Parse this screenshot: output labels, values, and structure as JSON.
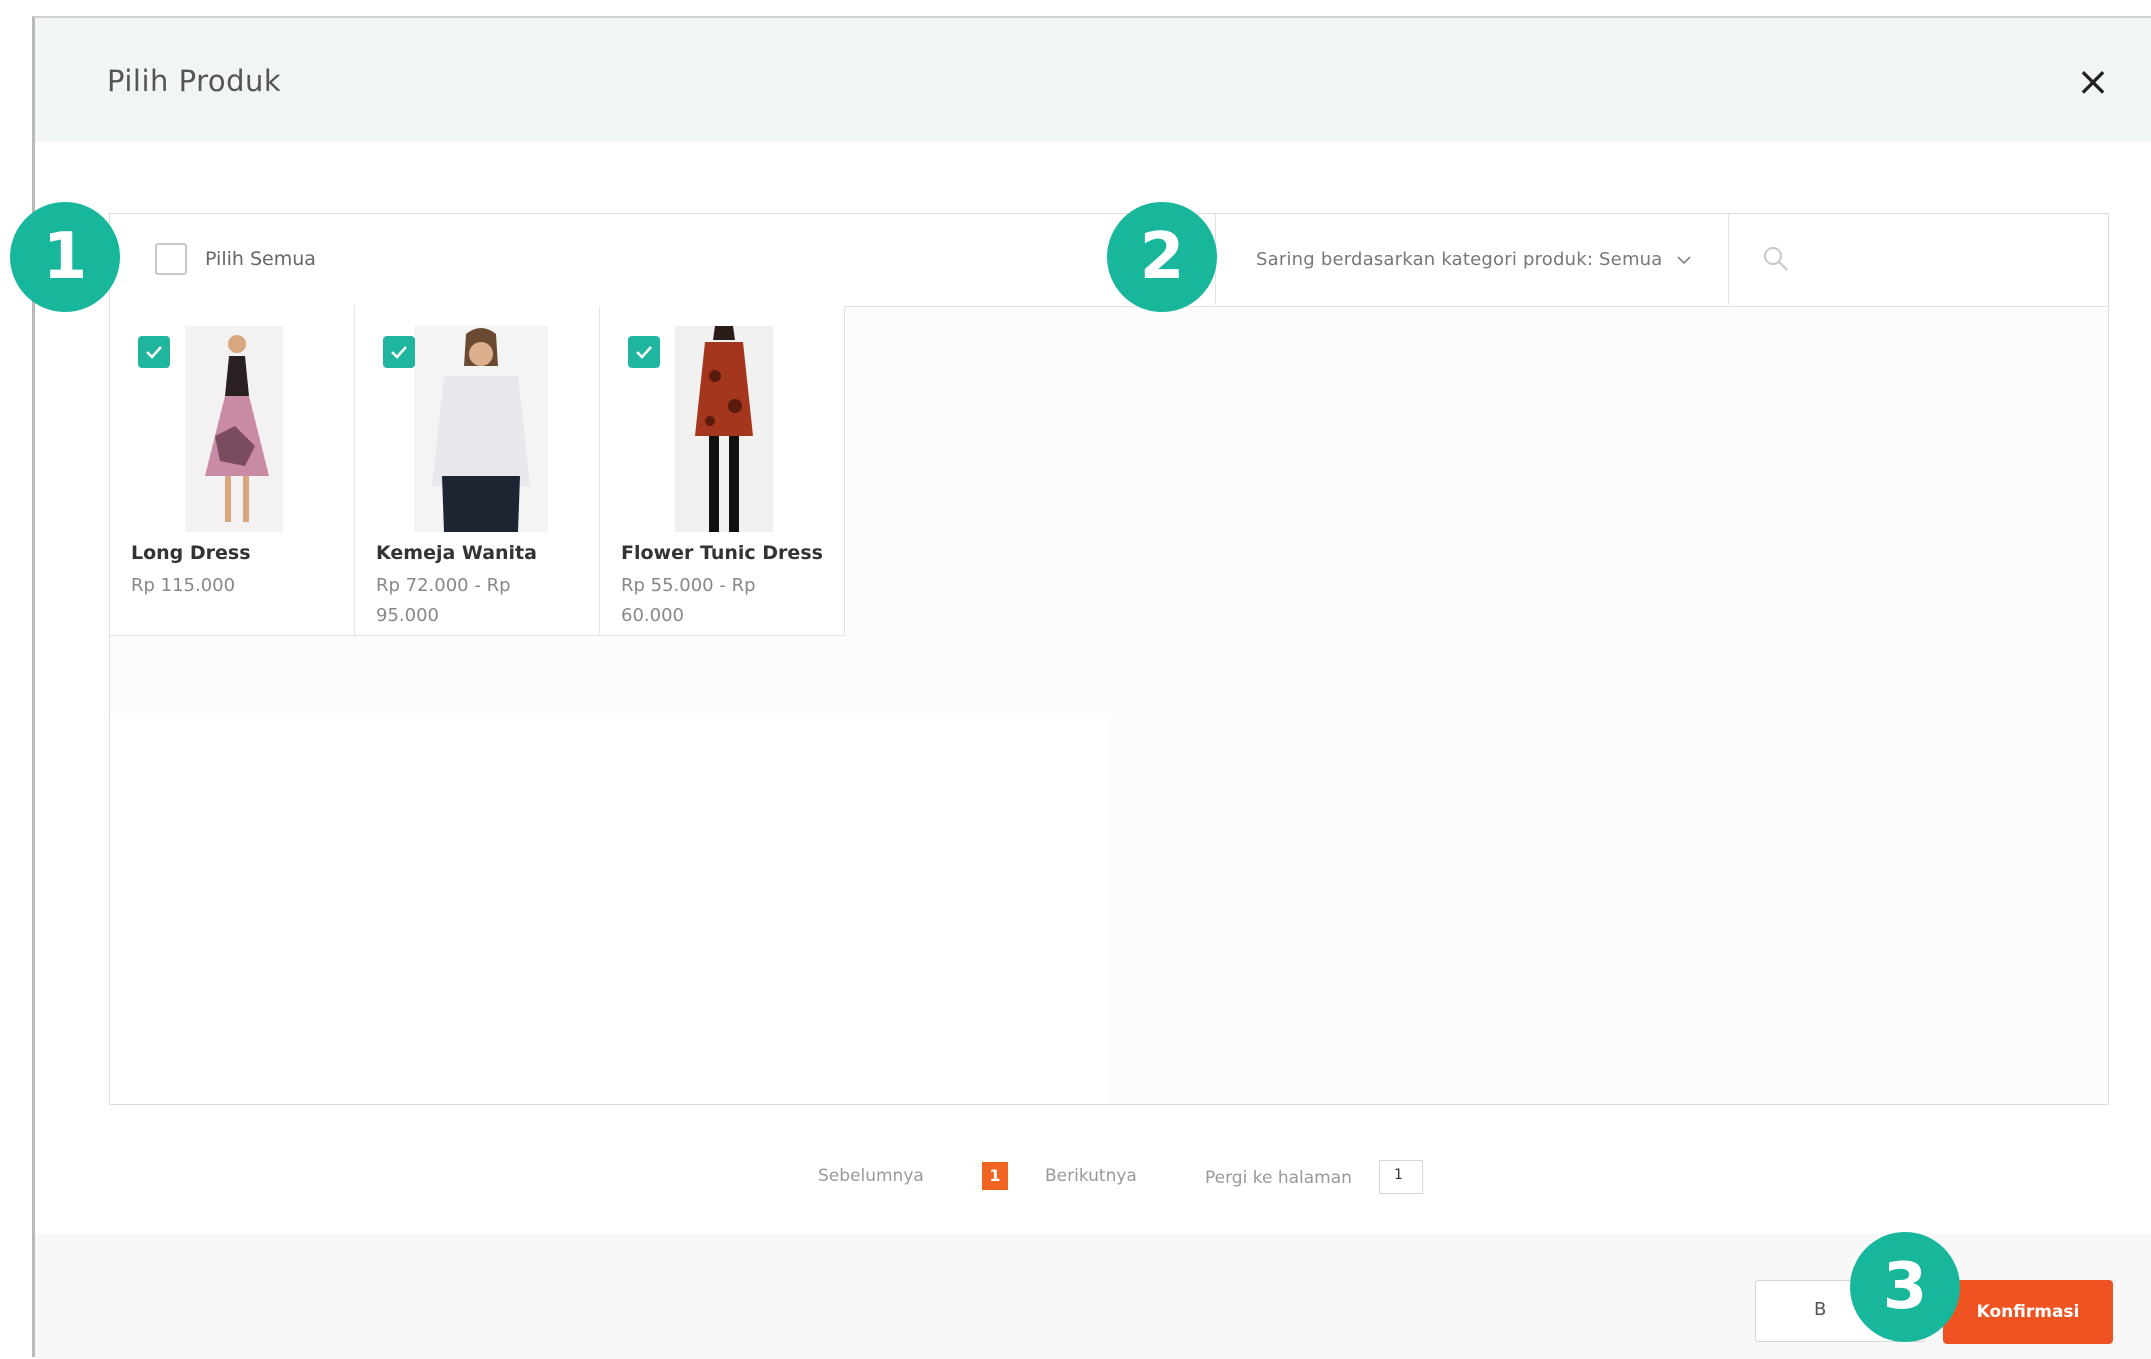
{
  "modal": {
    "title": "Pilih Produk",
    "close_icon": "close-icon"
  },
  "toolbar": {
    "select_all_label": "Pilih Semua",
    "filter_label": "Saring berdasarkan kategori produk: Semua",
    "search_placeholder": ""
  },
  "products": [
    {
      "name": "Long Dress",
      "price_line1": "Rp 115.000",
      "price_line2": "",
      "checked": true
    },
    {
      "name": "Kemeja Wanita",
      "price_line1": "Rp 72.000 - Rp",
      "price_line2": "95.000",
      "checked": true
    },
    {
      "name": "Flower Tunic Dress",
      "price_line1": "Rp 55.000 - Rp",
      "price_line2": "60.000",
      "checked": true
    }
  ],
  "pagination": {
    "prev_label": "Sebelumnya",
    "current_page": "1",
    "next_label": "Berikutnya",
    "goto_label": "Pergi ke halaman",
    "goto_value": "1"
  },
  "footer": {
    "cancel_label": "B",
    "confirm_label": "Konfirmasi"
  },
  "badges": [
    "1",
    "2",
    "3"
  ],
  "colors": {
    "accent_green": "#18b79b",
    "confirm_orange": "#f05322",
    "page_orange": "#f26422"
  }
}
